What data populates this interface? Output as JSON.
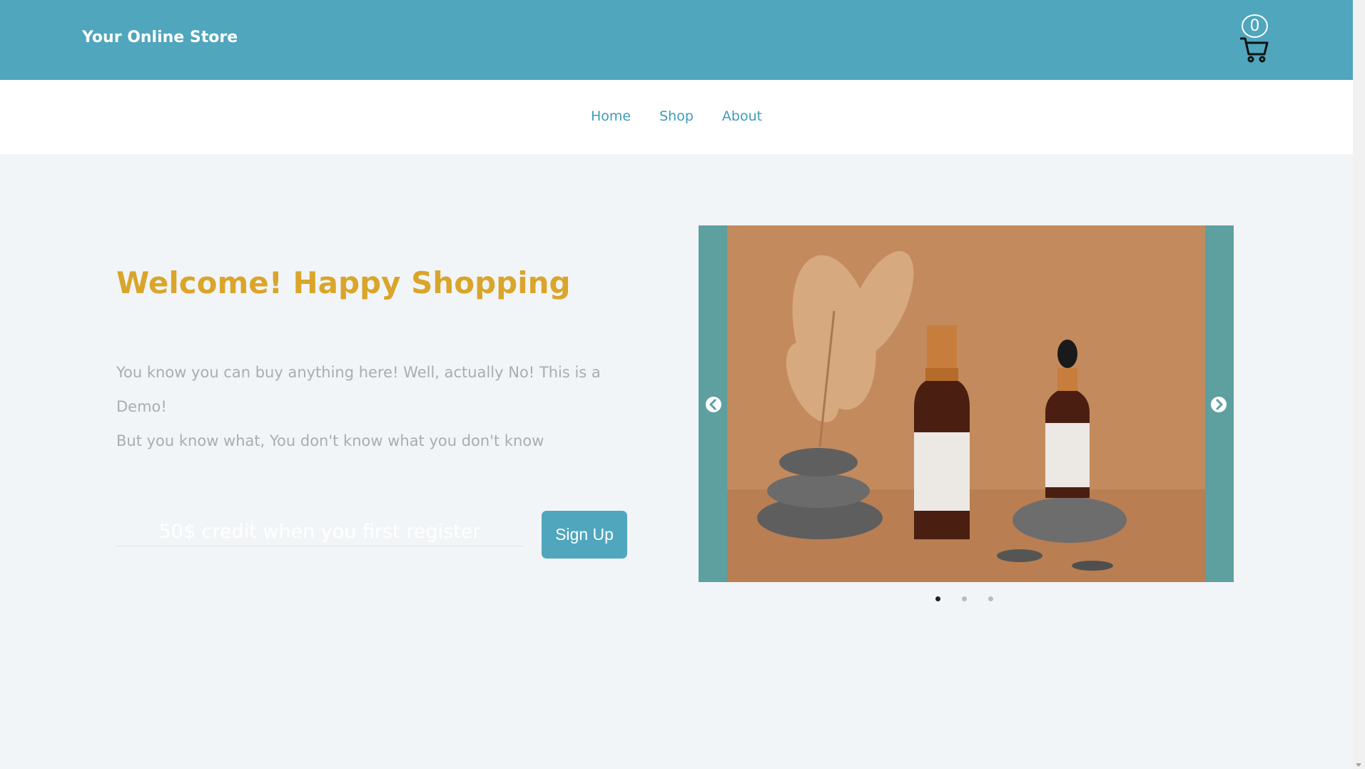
{
  "header": {
    "brand": "Your Online Store",
    "cart_count": "0",
    "icons": {
      "cart": "shopping-cart-icon"
    }
  },
  "nav": {
    "items": [
      {
        "label": "Home"
      },
      {
        "label": "Shop"
      },
      {
        "label": "About"
      }
    ]
  },
  "hero": {
    "title": "Welcome! Happy Shopping",
    "line1": "You know you can buy anything here! Well, actually No! This is a Demo!",
    "line2": "But you know what, You don't know what you don't know",
    "input_placeholder": "50$ credit when you first register",
    "signup_label": "Sign Up"
  },
  "carousel": {
    "active_slide": 1,
    "slide_count": 3,
    "icons": {
      "prev": "chevron-left-circle-icon",
      "next": "chevron-right-circle-icon"
    }
  },
  "colors": {
    "header_bg": "#4fa6bd",
    "nav_link": "#3f9bb8",
    "title": "#d9a52a",
    "body_text": "#a8adb2",
    "button_bg": "#4fa6bd",
    "page_bg": "#f2f5f7",
    "carousel_bg": "#5e9fa0"
  }
}
